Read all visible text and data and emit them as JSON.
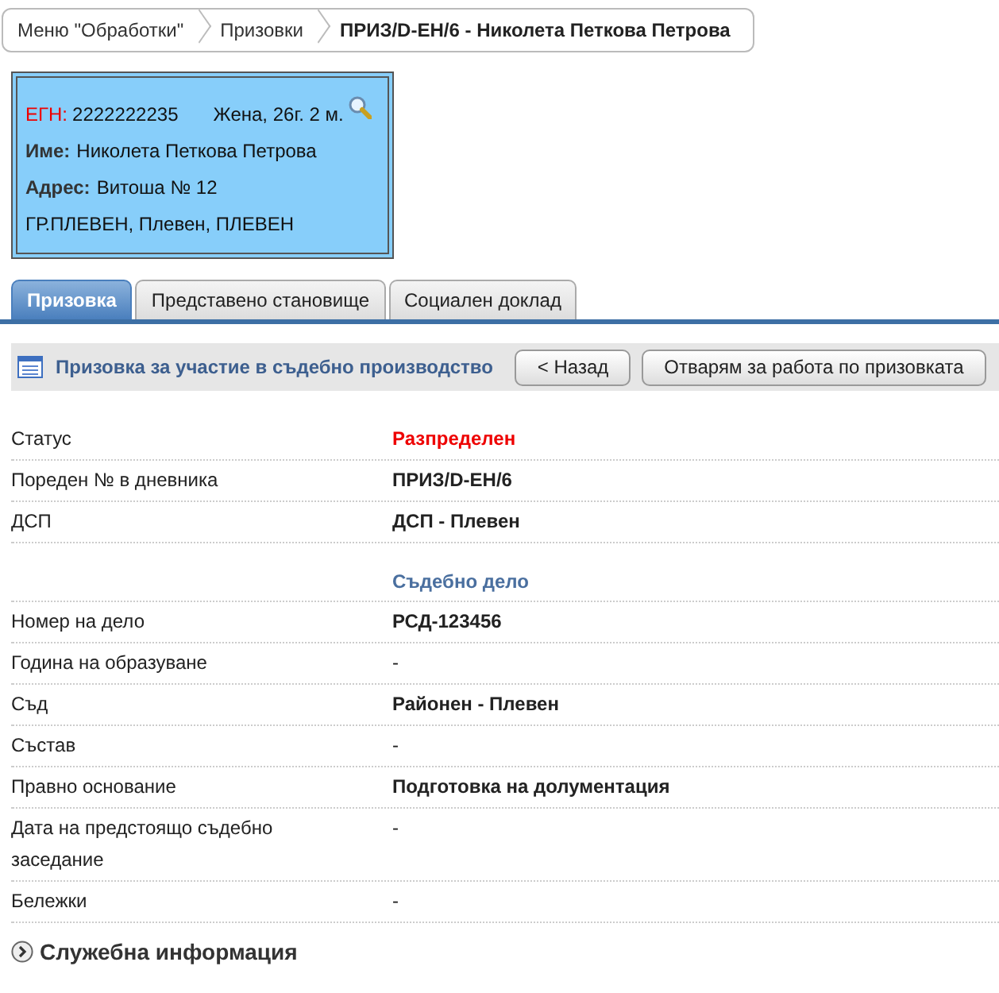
{
  "breadcrumb": [
    {
      "label": "Меню \"Обработки\"",
      "selected": false
    },
    {
      "label": "Призовки",
      "selected": false
    },
    {
      "label": "ПРИЗ/D-ЕН/6 - Николета Петкова Петрова",
      "selected": true
    }
  ],
  "person": {
    "egn_label": "ЕГН:",
    "egn": "2222222235",
    "gender_age": "Жена, 26г. 2 м.",
    "name_label": "Име:",
    "name": "Николета Петкова Петрова",
    "address_label": "Адрес:",
    "address": "Витоша № 12",
    "city": "ГР.ПЛЕВЕН, Плевен, ПЛЕВЕН"
  },
  "tabs": [
    {
      "label": "Призовка",
      "selected": true
    },
    {
      "label": "Представено становище",
      "selected": false
    },
    {
      "label": "Социален доклад",
      "selected": false
    }
  ],
  "toolbar": {
    "title": "Призовка за участие в съдебно производство",
    "buttons": [
      "< Назад",
      "Отварям за работа по призовката"
    ]
  },
  "rows": [
    {
      "kind": "status",
      "label": "Статус",
      "value": "Разпределен"
    },
    {
      "kind": "bold",
      "label": "Пореден № в дневника",
      "value": "ПРИЗ/D-ЕН/6"
    },
    {
      "kind": "bold",
      "label": "ДСП",
      "value": "ДСП - Плевен"
    },
    {
      "kind": "heading",
      "value": "Съдебно дело"
    },
    {
      "kind": "bold",
      "label": "Номер на дело",
      "value": "РСД-123456"
    },
    {
      "kind": "plain",
      "label": "Година на образуване",
      "value": "-"
    },
    {
      "kind": "bold",
      "label": "Съд",
      "value": "Районен - Плевен"
    },
    {
      "kind": "plain",
      "label": "Състав",
      "value": "-"
    },
    {
      "kind": "bold",
      "label": "Правно основание",
      "value": "Подготовка на долументация"
    },
    {
      "kind": "plain",
      "label": "Дата на предстоящо съдебно заседание",
      "value": "-"
    },
    {
      "kind": "plain",
      "label": "Бележки",
      "value": "-"
    }
  ],
  "section": {
    "label": "Служебна информация",
    "expanded": false
  }
}
